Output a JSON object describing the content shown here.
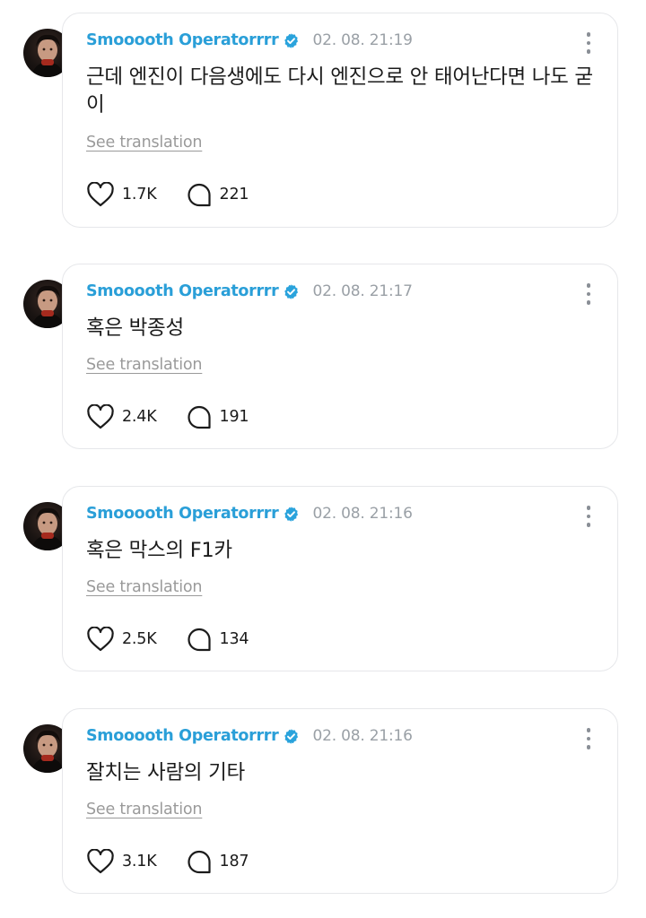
{
  "posts": [
    {
      "username": "Smooooth Operatorrrr",
      "timestamp": "02. 08. 21:19",
      "text": "근데 엔진이 다음생에도 다시 엔진으로 안 태어난다면 나도 굳이",
      "translate_label": "See translation",
      "likes": "1.7K",
      "comments": "221"
    },
    {
      "username": "Smooooth Operatorrrr",
      "timestamp": "02. 08. 21:17",
      "text": "혹은 박종성",
      "translate_label": "See translation",
      "likes": "2.4K",
      "comments": "191"
    },
    {
      "username": "Smooooth Operatorrrr",
      "timestamp": "02. 08. 21:16",
      "text": "혹은 막스의 F1카",
      "translate_label": "See translation",
      "likes": "2.5K",
      "comments": "134"
    },
    {
      "username": "Smooooth Operatorrrr",
      "timestamp": "02. 08. 21:16",
      "text": "잘치는 사람의 기타",
      "translate_label": "See translation",
      "likes": "3.1K",
      "comments": "187"
    }
  ],
  "icons": {
    "verified": "verified-badge-icon",
    "more": "more-vertical-icon",
    "like": "heart-icon",
    "comment": "comment-bubble-icon"
  },
  "colors": {
    "username": "#2a9fd8",
    "verified": "#2aa3dc",
    "timestamp": "#9aa0a6",
    "body_text": "#1b1b1b",
    "translate": "#9a9a9a",
    "card_border": "#e6e7ea"
  }
}
